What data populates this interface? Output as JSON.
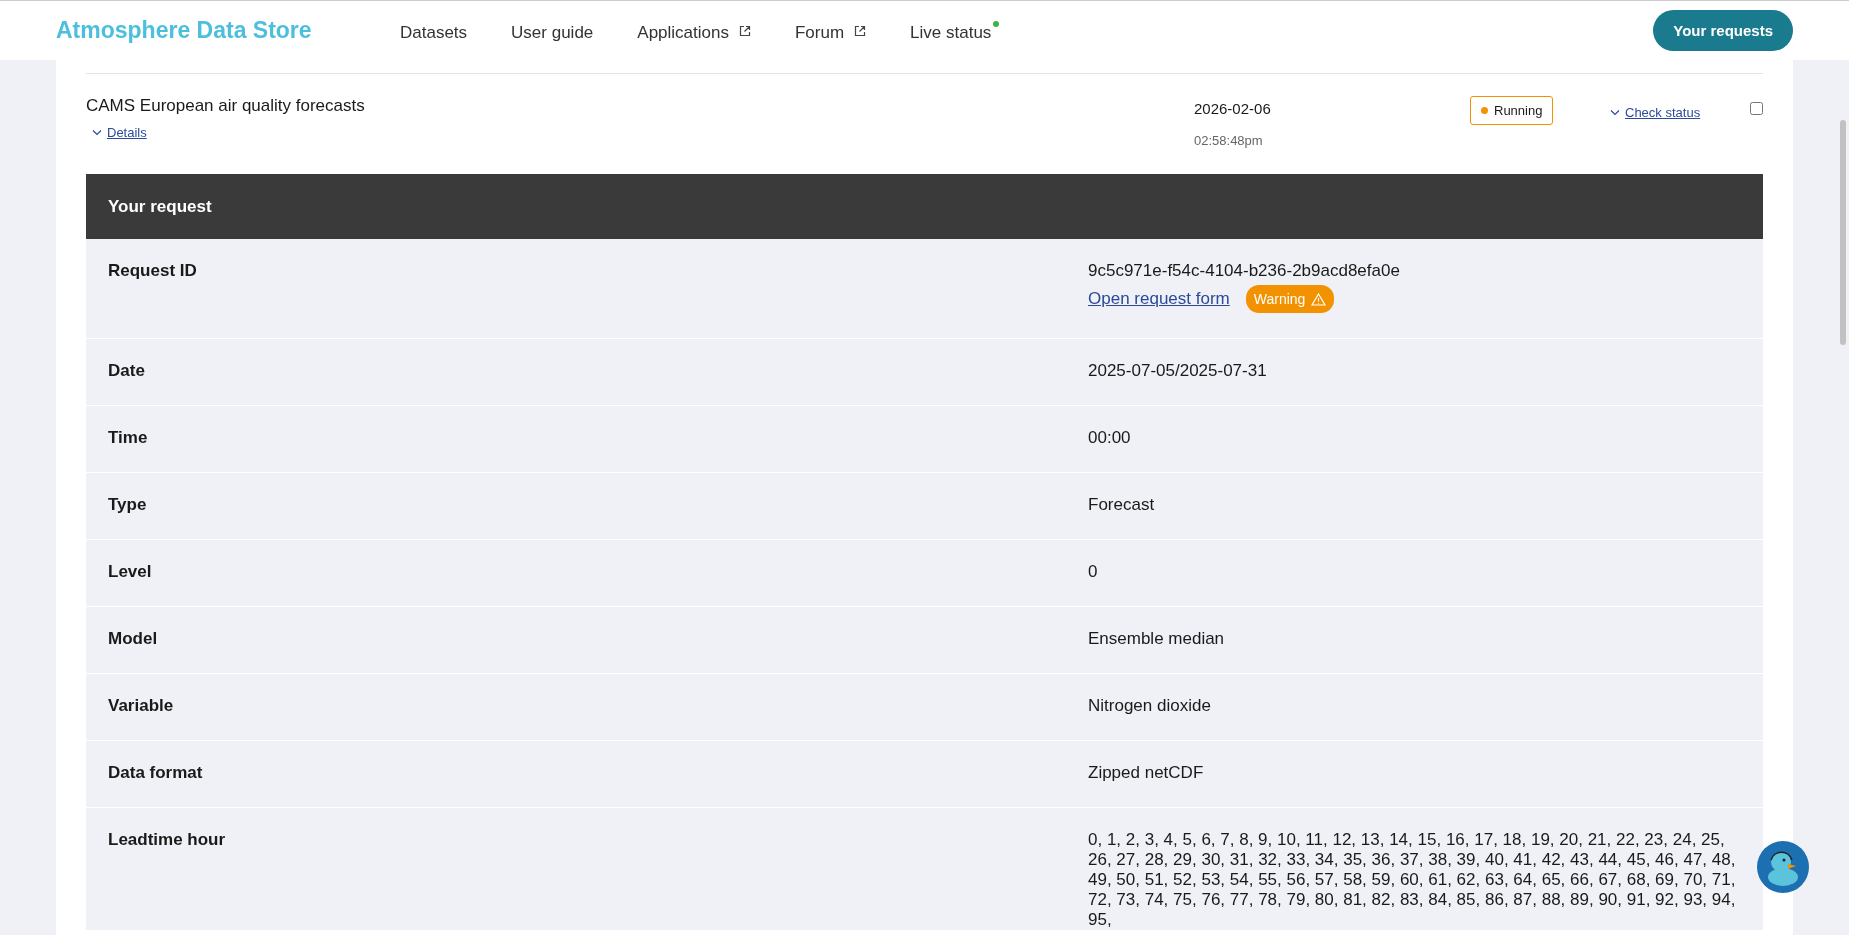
{
  "header": {
    "logo": "Atmosphere Data Store",
    "nav": [
      {
        "label": "Datasets",
        "kind": "plain"
      },
      {
        "label": "User guide",
        "kind": "plain"
      },
      {
        "label": "Applications",
        "kind": "external"
      },
      {
        "label": "Forum",
        "kind": "external"
      },
      {
        "label": "Live status",
        "kind": "status"
      }
    ],
    "requests_button": "Your requests"
  },
  "request": {
    "title": "CAMS European air quality forecasts",
    "details_link": "Details",
    "date": "2026-02-06",
    "time": "02:58:48pm",
    "status": "Running",
    "check_status_link": "Check status",
    "checked": false
  },
  "details": {
    "heading": "Your request",
    "rows": [
      {
        "label": "Request ID",
        "value": "9c5c971e-f54c-4104-b236-2b9acd8efa0e",
        "link": "Open request form",
        "badge": "Warning"
      },
      {
        "label": "Date",
        "value": "2025-07-05/2025-07-31"
      },
      {
        "label": "Time",
        "value": "00:00"
      },
      {
        "label": "Type",
        "value": "Forecast"
      },
      {
        "label": "Level",
        "value": "0"
      },
      {
        "label": "Model",
        "value": "Ensemble median"
      },
      {
        "label": "Variable",
        "value": "Nitrogen dioxide"
      },
      {
        "label": "Data format",
        "value": "Zipped netCDF"
      },
      {
        "label": "Leadtime hour",
        "value": "0, 1, 2, 3, 4, 5, 6, 7, 8, 9, 10, 11, 12, 13, 14, 15, 16, 17, 18, 19, 20, 21, 22, 23, 24, 25, 26, 27, 28, 29, 30, 31, 32, 33, 34, 35, 36, 37, 38, 39, 40, 41, 42, 43, 44, 45, 46, 47, 48, 49, 50, 51, 52, 53, 54, 55, 56, 57, 58, 59, 60, 61, 62, 63, 64, 65, 66, 67, 68, 69, 70, 71, 72, 73, 74, 75, 76, 77, 78, 79, 80, 81, 82, 83, 84, 85, 86, 87, 88, 89, 90, 91, 92, 93, 94, 95,"
      }
    ]
  }
}
